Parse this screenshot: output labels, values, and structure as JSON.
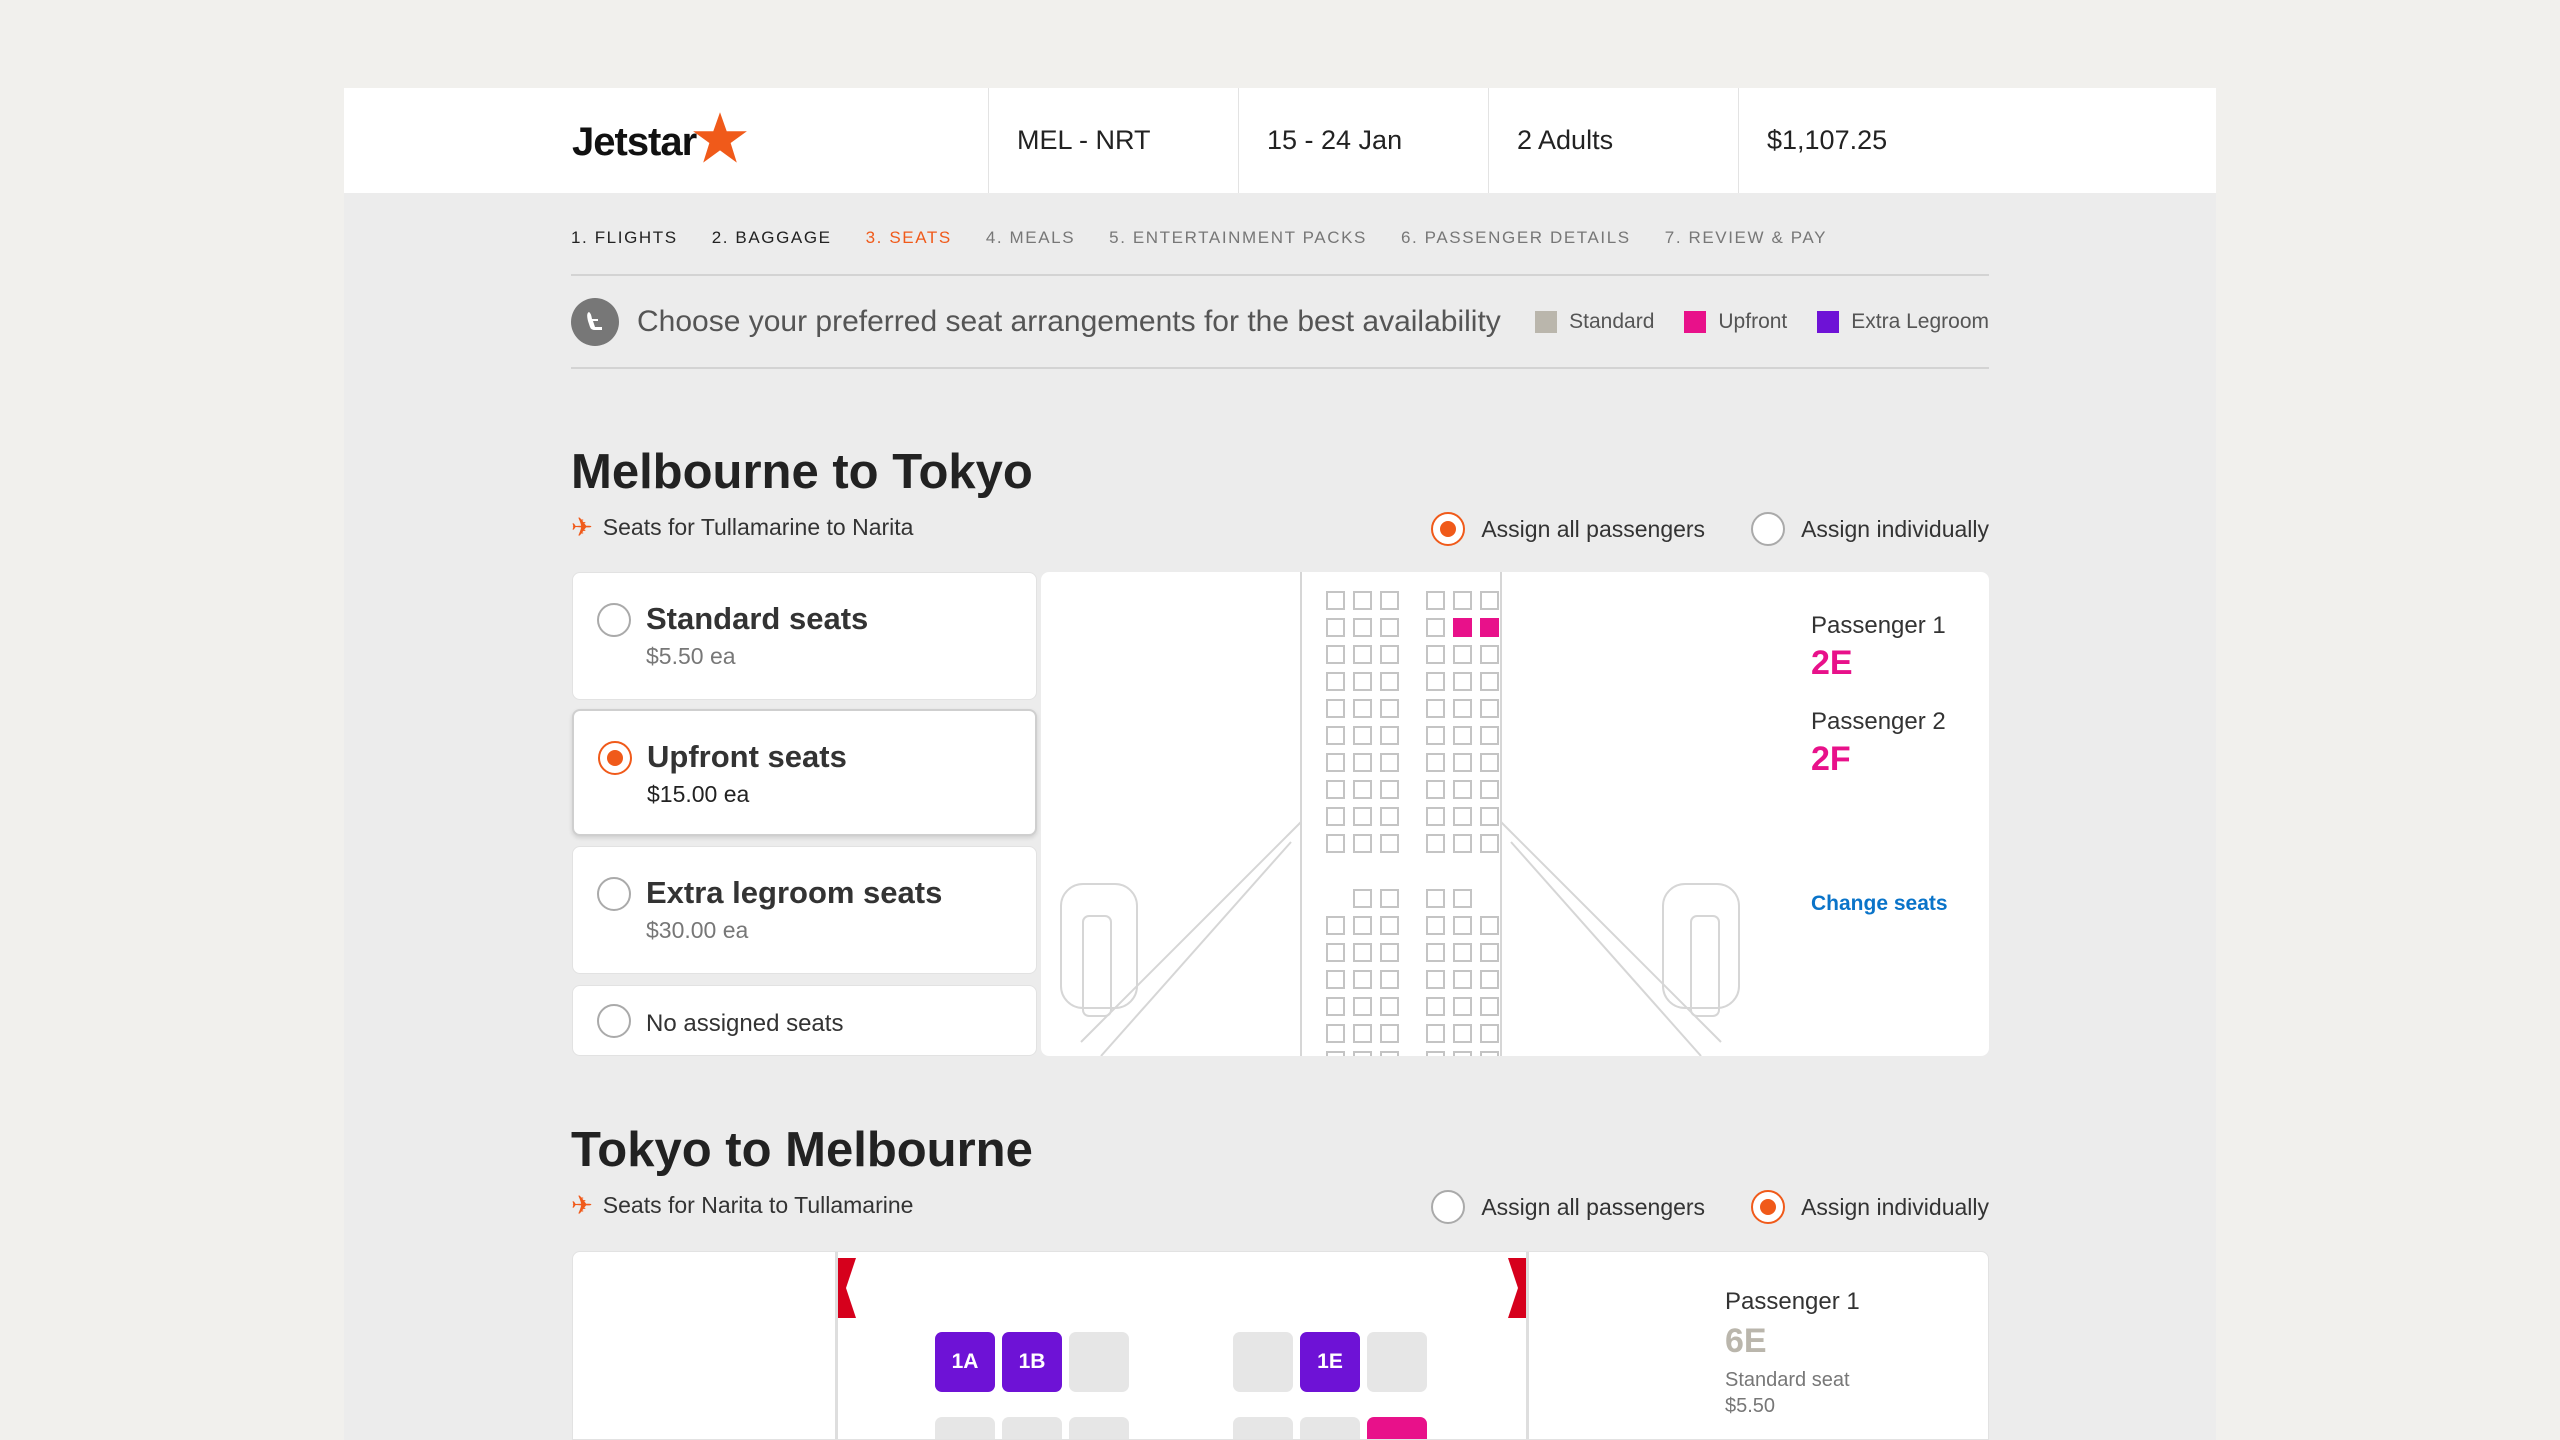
{
  "header": {
    "brand": "Jetstar",
    "route": "MEL - NRT",
    "dates": "15 - 24 Jan",
    "passengers": "2 Adults",
    "total": "$1,107.25"
  },
  "steps": [
    {
      "label": "1. FLIGHTS",
      "state": "done"
    },
    {
      "label": "2. BAGGAGE",
      "state": "done"
    },
    {
      "label": "3. SEATS",
      "state": "active"
    },
    {
      "label": "4. MEALS",
      "state": "todo"
    },
    {
      "label": "5. ENTERTAINMENT PACKS",
      "state": "todo"
    },
    {
      "label": "6. PASSENGER DETAILS",
      "state": "todo"
    },
    {
      "label": "7. REVIEW & PAY",
      "state": "todo"
    }
  ],
  "info": {
    "text": "Choose your preferred seat arrangements for the best availability",
    "legend": [
      {
        "label": "Standard",
        "color": "#bab6ac"
      },
      {
        "label": "Upfront",
        "color": "#e8118a"
      },
      {
        "label": "Extra Legroom",
        "color": "#6e12d6"
      }
    ]
  },
  "outbound": {
    "title": "Melbourne to Tokyo",
    "subtitle": "Seats for Tullamarine to Narita",
    "assign_all": "Assign all passengers",
    "assign_individual": "Assign individually",
    "assign_mode": "all",
    "options": [
      {
        "title": "Standard seats",
        "price": "$5.50 ea",
        "selected": false
      },
      {
        "title": "Upfront seats",
        "price": "$15.00 ea",
        "selected": true
      },
      {
        "title": "Extra legroom seats",
        "price": "$30.00 ea",
        "selected": false
      },
      {
        "title": "No assigned seats",
        "price": "",
        "selected": false
      }
    ],
    "passengers": [
      {
        "label": "Passenger 1",
        "seat": "2E"
      },
      {
        "label": "Passenger 2",
        "seat": "2F"
      }
    ],
    "change_seats": "Change seats"
  },
  "return": {
    "title": "Tokyo to Melbourne",
    "subtitle": "Seats for Narita to Tullamarine",
    "assign_all": "Assign all passengers",
    "assign_individual": "Assign individually",
    "assign_mode": "individual",
    "seats_row1": [
      "1A",
      "1B",
      "",
      "",
      "1E",
      ""
    ],
    "passenger": {
      "label": "Passenger 1",
      "seat": "6E",
      "type": "Standard seat",
      "price": "$5.50"
    }
  },
  "colors": {
    "accent": "#f05a1a",
    "upfront": "#e8118a",
    "extra_legroom": "#6e12d6",
    "standard": "#bab6ac",
    "link": "#0a74c9"
  }
}
